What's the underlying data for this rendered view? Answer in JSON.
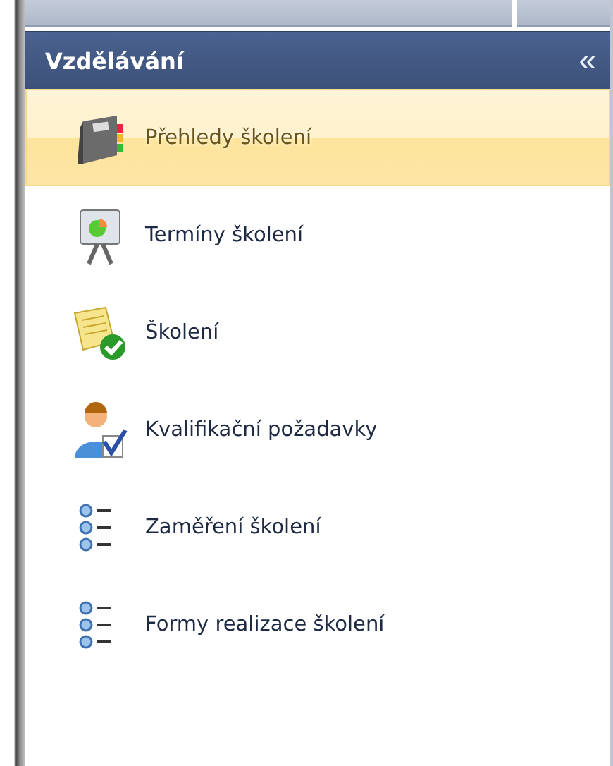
{
  "panel": {
    "title": "Vzdělávání",
    "collapse_glyph": "«"
  },
  "items": [
    {
      "label": "Přehledy školení",
      "kind": "book",
      "selected": true
    },
    {
      "label": "Termíny školení",
      "kind": "presentation",
      "selected": false
    },
    {
      "label": "Školení",
      "kind": "document-check",
      "selected": false
    },
    {
      "label": "Kvalifikační požadavky",
      "kind": "user-check",
      "selected": false
    },
    {
      "label": "Zaměření školení",
      "kind": "list",
      "selected": false
    },
    {
      "label": "Formy realizace školení",
      "kind": "list",
      "selected": false
    }
  ]
}
